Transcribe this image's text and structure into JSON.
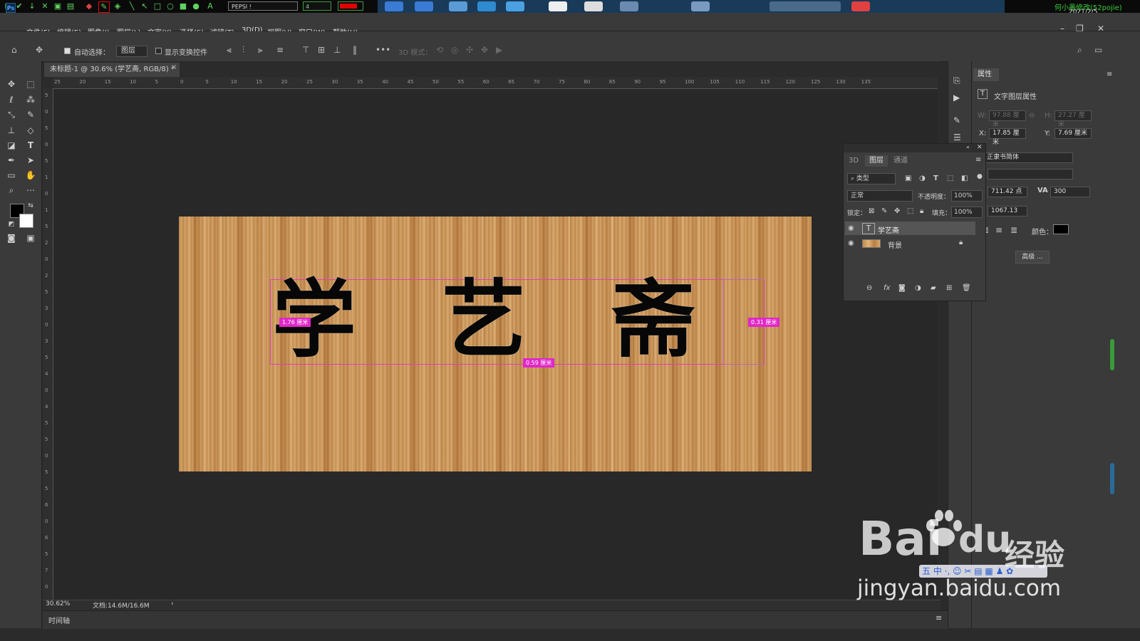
{
  "top_strip": {
    "font_select": "PEPSI !",
    "size_select": "4",
    "owner": "何小墨修改(52pojie)",
    "date": "2021/2/5"
  },
  "menubar": {
    "items": [
      "文件(F)",
      "编辑(E)",
      "图像(I)",
      "图层(L)",
      "文字(Y)",
      "选择(S)",
      "滤镜(T)",
      "3D(D)",
      "视图(V)",
      "窗口(W)",
      "帮助(H)"
    ]
  },
  "options": {
    "auto_select_label": "自动选择：",
    "layer_dropdown": "图层",
    "show_transform_label": "显示变换控件",
    "mode_3d_label": "3D 模式："
  },
  "document": {
    "tab_title": "未标题-1 @ 30.6% (学艺斋, RGB/8) *",
    "text_chars": [
      "学",
      "艺",
      "斋"
    ],
    "measure_left": "1.76 厘米",
    "measure_bottom": "0.59 厘米",
    "measure_right": "0.31 厘米"
  },
  "rulers": {
    "h_ticks": [
      "25",
      "20",
      "15",
      "10",
      "5",
      "0",
      "5",
      "10",
      "15",
      "20",
      "25",
      "30",
      "35",
      "40",
      "45",
      "50",
      "55",
      "60",
      "65",
      "70",
      "75",
      "80",
      "85",
      "90",
      "95",
      "100",
      "105",
      "110",
      "115",
      "120",
      "125",
      "130",
      "135"
    ],
    "v_ticks": [
      "5",
      "0",
      "5",
      "0",
      "5",
      "1",
      "0",
      "1",
      "5",
      "2",
      "0",
      "2",
      "5",
      "3",
      "0",
      "3",
      "5",
      "4",
      "0",
      "4",
      "5",
      "5",
      "0",
      "5",
      "5",
      "6",
      "0",
      "6",
      "5",
      "7",
      "0"
    ]
  },
  "status": {
    "zoom": "30.62%",
    "doc_size": "文档:14.6M/16.6M",
    "timeline": "时间轴"
  },
  "properties": {
    "tab": "属性",
    "section_title": "文字图层属性",
    "w_label": "W:",
    "w_value": "97.88 厘米",
    "h_label": "H:",
    "h_value": "27.27 厘米",
    "x_label": "X:",
    "x_value": "17.85 厘米",
    "y_label": "Y:",
    "y_value": "7.69 厘米",
    "font": "正隶书简体",
    "font_size": "711.42 点",
    "tracking": "300",
    "leading": "1067.13",
    "color_label": "颜色：",
    "advanced_button": "高级 ..."
  },
  "layers_panel": {
    "tabs": [
      "3D",
      "图层",
      "通道"
    ],
    "filter": "类型",
    "blend_mode": "正常",
    "opacity_label": "不透明度：",
    "opacity": "100%",
    "lock_label": "锁定：",
    "fill_label": "填充：",
    "fill": "100%",
    "layers": [
      {
        "name": "学艺斋",
        "type": "text"
      },
      {
        "name": "背景",
        "type": "image"
      }
    ]
  },
  "watermark": {
    "brand": "Bai",
    "du": "du",
    "jingyan": "经验",
    "url": "jingyan.baidu.com"
  },
  "colors": {
    "selection_pink": "#e028c8",
    "foreground": "#000000",
    "background": "#ffffff",
    "layer_text_color": "#000000"
  }
}
